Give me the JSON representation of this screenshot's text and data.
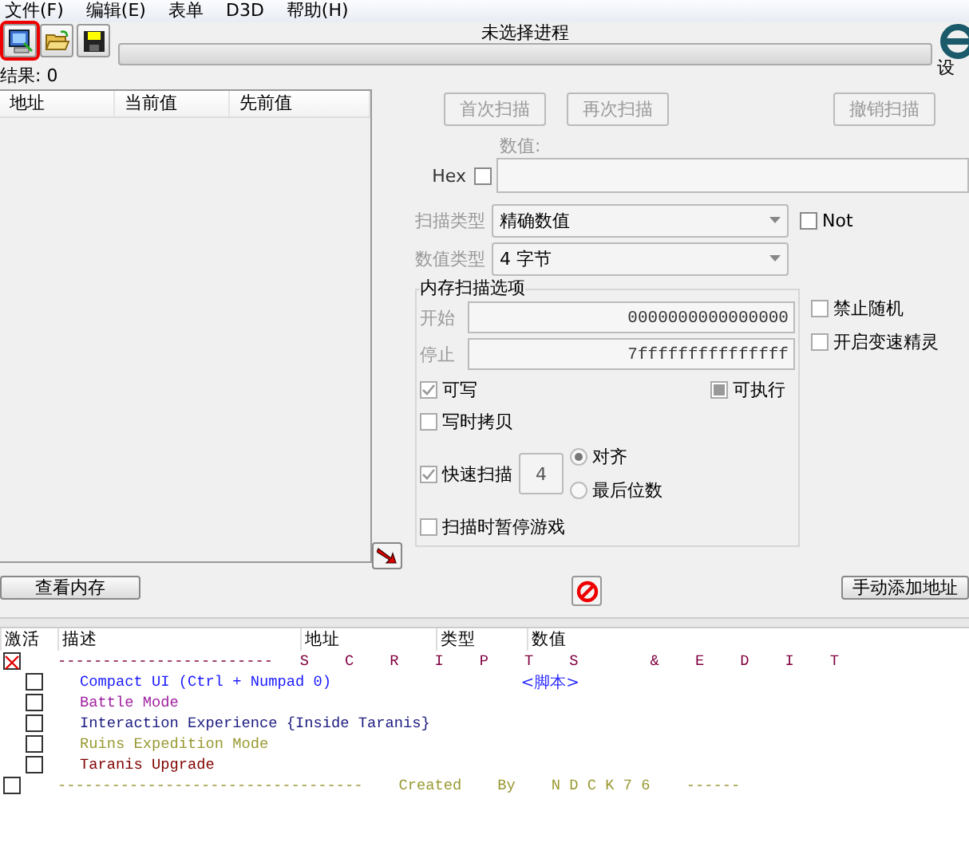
{
  "menu": [
    {
      "label": "文件(F)"
    },
    {
      "label": "编辑(E)"
    },
    {
      "label": "表单"
    },
    {
      "label": "D3D"
    },
    {
      "label": "帮助(H)"
    }
  ],
  "process_title": "未选择进程",
  "progress": {
    "level": 0
  },
  "settings_label": "设",
  "results_label": "结果: 0",
  "found_list": {
    "columns": [
      "地址",
      "当前值",
      "先前值"
    ]
  },
  "scan_buttons": [
    {
      "label": "首次扫描",
      "disabled": true
    },
    {
      "label": "再次扫描",
      "disabled": true
    },
    {
      "label": "撤销扫描",
      "disabled": true
    }
  ],
  "value": {
    "label": "数值:",
    "hex_label": "Hex",
    "hex_checked": false
  },
  "scan_type": {
    "label": "扫描类型",
    "value": "精确数值"
  },
  "value_type": {
    "label": "数值类型",
    "value": "4 字节"
  },
  "not_option": {
    "label": "Not",
    "checked": false
  },
  "memory_options": {
    "title": "内存扫描选项",
    "start": {
      "label": "开始",
      "value": "0000000000000000"
    },
    "stop": {
      "label": "停止",
      "value": "7fffffffffffffff"
    },
    "writable": {
      "label": "可写",
      "checked": true
    },
    "executable": {
      "label": "可执行",
      "checked": false,
      "indeterminate": true
    },
    "copy_on_write": {
      "label": "写时拷贝",
      "checked": false
    },
    "fast_scan": {
      "label": "快速扫描",
      "checked": true,
      "value": "4"
    },
    "alignment": [
      {
        "label": "对齐",
        "selected": true
      },
      {
        "label": "最后位数",
        "selected": false
      }
    ],
    "pause_game": {
      "label": "扫描时暂停游戏",
      "checked": false
    }
  },
  "side_options": [
    {
      "label": "禁止随机",
      "checked": false
    },
    {
      "label": "开启变速精灵",
      "checked": false
    }
  ],
  "view_memory_button": "查看内存",
  "add_address_button": "手动添加地址",
  "cheat_table": {
    "columns": [
      "激活",
      "描述",
      "地址",
      "类型",
      "数值"
    ],
    "rows": [
      {
        "checked": true,
        "description": "------------------------   S    C    R    I    P    T    S        &    E    D    I    T",
        "color": "#800040",
        "children": [
          {
            "checked": false,
            "description": "Compact UI (Ctrl + Numpad 0)",
            "value": "<脚本>",
            "color": "#1a1aff"
          },
          {
            "checked": false,
            "description": "Battle Mode",
            "color": "#a020a0"
          },
          {
            "checked": false,
            "description": "Interaction Experience {Inside Taranis}",
            "color": "#1a1a80"
          },
          {
            "checked": false,
            "description": "Ruins Expedition Mode",
            "color": "#999933"
          },
          {
            "checked": false,
            "description": "Taranis Upgrade",
            "color": "#800000"
          }
        ]
      },
      {
        "checked": false,
        "description": "----------------------------------    Created    By    N D C K 7 6    ------",
        "color": "#999933"
      }
    ]
  }
}
